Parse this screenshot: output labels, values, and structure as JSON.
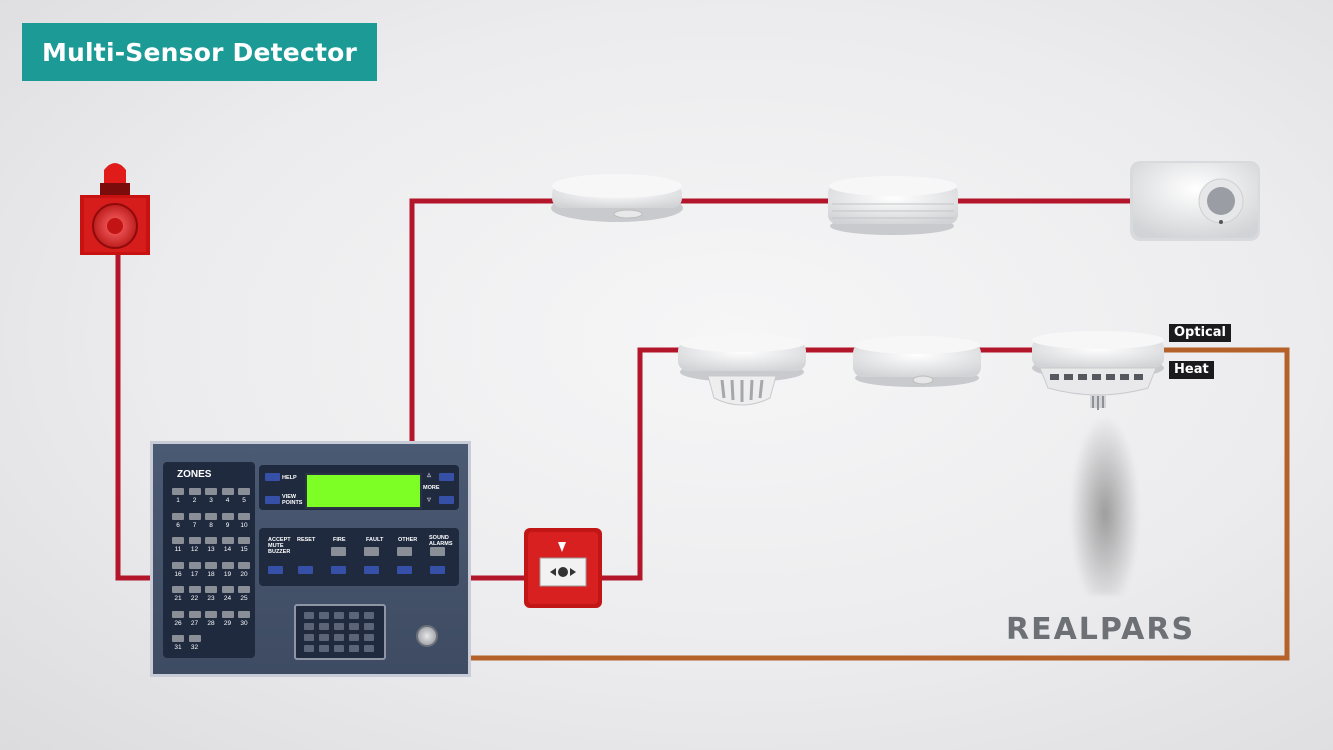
{
  "title": "Multi-Sensor Detector",
  "labels": {
    "optical": "Optical",
    "heat": "Heat"
  },
  "logo": "REALPARS",
  "panel": {
    "zones_title": "ZONES",
    "zones": [
      "1",
      "2",
      "3",
      "4",
      "5",
      "6",
      "7",
      "8",
      "9",
      "10",
      "11",
      "12",
      "13",
      "14",
      "15",
      "16",
      "17",
      "18",
      "19",
      "20",
      "21",
      "22",
      "23",
      "24",
      "25",
      "26",
      "27",
      "28",
      "29",
      "30",
      "31",
      "32"
    ],
    "display_buttons": {
      "help": "HELP",
      "view_points": "VIEW POINTS",
      "more": "MORE"
    },
    "controls": [
      "ACCEPT MUTE BUZZER",
      "RESET",
      "FIRE",
      "FAULT",
      "OTHER",
      "SOUND ALARMS"
    ]
  },
  "colors": {
    "title_bg": "#1c9a96",
    "wire_red": "#b3152a",
    "wire_orange": "#b5622a",
    "lcd": "#7dff25"
  }
}
